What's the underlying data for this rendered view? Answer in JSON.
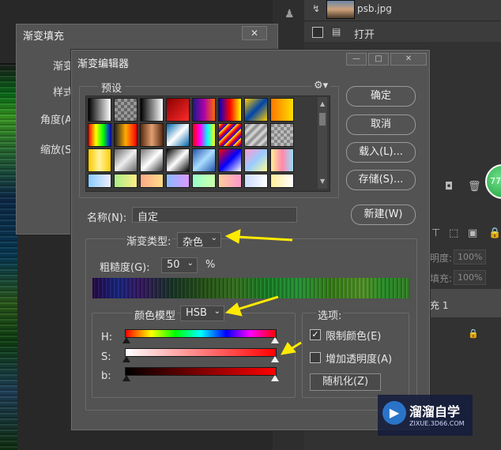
{
  "layers_panel": {
    "file_name": "psb.jpg",
    "layer_open_label": "打开",
    "opacity_label": "明度:",
    "opacity_value": "100%",
    "fill_label": "填充:",
    "fill_value": "100%",
    "layer_name": "充 1",
    "badge_text": "77"
  },
  "back_dialog": {
    "title": "渐变填充",
    "close_label": "✕",
    "labels": [
      "渐变",
      "样式",
      "角度(A)",
      "缩放(S)"
    ]
  },
  "gradient_editor": {
    "title": "渐变编辑器",
    "presets_label": "预设",
    "gear_icon": "gear-icon",
    "buttons": {
      "ok": "确定",
      "cancel": "取消",
      "load": "载入(L)...",
      "save": "存储(S)...",
      "new": "新建(W)"
    },
    "name_label": "名称(N):",
    "name_value": "自定",
    "gradient_type_label": "渐变类型:",
    "gradient_type_value": "杂色",
    "roughness_label": "粗糙度(G):",
    "roughness_value": "50",
    "roughness_unit": "%",
    "color_model_label": "颜色模型",
    "color_model_value": "HSB",
    "sliders": [
      {
        "label": "H:",
        "low": 0,
        "high": 1
      },
      {
        "label": "S:",
        "low": 0,
        "high": 1
      },
      {
        "label": "b:",
        "low": 0,
        "high": 1
      }
    ],
    "options_label": "选项:",
    "restrict_colors_label": "限制颜色(E)",
    "restrict_colors_checked": true,
    "add_transparency_label": "增加透明度(A)",
    "add_transparency_checked": false,
    "randomize_label": "随机化(Z)"
  },
  "watermark": {
    "title": "溜溜自学",
    "subtitle": "ZIXUE.3D66.COM"
  },
  "colors": {
    "annotation_arrow": "#ffea00",
    "dialog_bg": "#535353"
  }
}
